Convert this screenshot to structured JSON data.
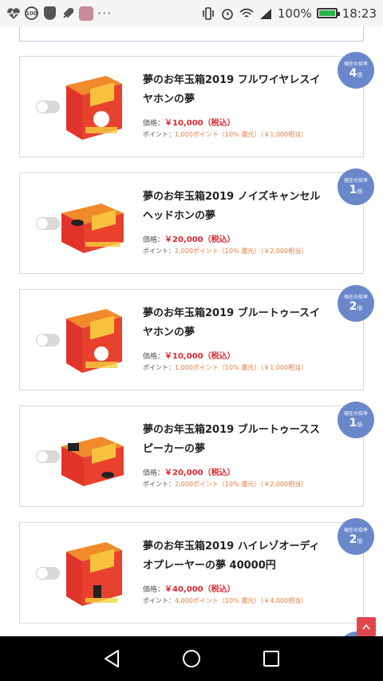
{
  "status_bar": {
    "battery_percent": "100%",
    "time": "18:23",
    "badge_100": "100",
    "icons": [
      "heart-rate-icon",
      "hundred-badge-icon",
      "shield-icon",
      "rocket-icon",
      "avatar-icon",
      "more-dots-icon",
      "vibrate-icon",
      "alarm-icon",
      "wifi-icon",
      "signal-icon",
      "battery-icon"
    ]
  },
  "products": [
    {
      "title": "夢のお年玉箱2019 フルワイヤレスイヤホンの夢",
      "price_label": "価格：",
      "price": "￥10,000（税込）",
      "points_label": "ポイント：",
      "points": "1,000ポイント（10% 還元）（￥1,000相当）",
      "badge_label": "現在の倍率",
      "multiplier": "4",
      "multiplier_unit": "倍"
    },
    {
      "title": "夢のお年玉箱2019 ノイズキャンセルヘッドホンの夢",
      "price_label": "価格：",
      "price": "￥20,000（税込）",
      "points_label": "ポイント：",
      "points": "2,000ポイント（10% 還元）（￥2,000相当）",
      "badge_label": "現在の倍率",
      "multiplier": "1",
      "multiplier_unit": "倍"
    },
    {
      "title": "夢のお年玉箱2019 ブルートゥースイヤホンの夢",
      "price_label": "価格：",
      "price": "￥10,000（税込）",
      "points_label": "ポイント：",
      "points": "1,000ポイント（10% 還元）（￥1,000相当）",
      "badge_label": "現在の倍率",
      "multiplier": "2",
      "multiplier_unit": "倍"
    },
    {
      "title": "夢のお年玉箱2019 ブルートゥーススピーカーの夢",
      "price_label": "価格：",
      "price": "￥20,000（税込）",
      "points_label": "ポイント：",
      "points": "2,000ポイント（10% 還元）（￥2,000相当）",
      "badge_label": "現在の倍率",
      "multiplier": "1",
      "multiplier_unit": "倍"
    },
    {
      "title": "夢のお年玉箱2019 ハイレゾオーディオプレーヤーの夢 40000円",
      "price_label": "価格：",
      "price": "￥40,000（税込）",
      "points_label": "ポイント：",
      "points": "4,000ポイント（10% 還元）（￥4,000相当）",
      "badge_label": "現在の倍率",
      "multiplier": "2",
      "multiplier_unit": "倍"
    }
  ],
  "page_top_icon": "chevron-up-icon",
  "nav": [
    "back-icon",
    "home-icon",
    "recents-icon"
  ],
  "colors": {
    "price": "#e0262f",
    "points": "#e8783c",
    "badge": "#6a88c9",
    "page_top": "#e0474c"
  }
}
